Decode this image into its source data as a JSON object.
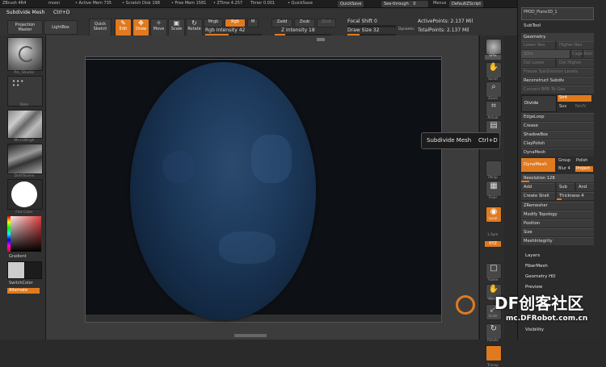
{
  "topbar": {
    "app": "ZBrush 4R4",
    "doc": "moon",
    "active_mem": "• Active Mem 735",
    "scratch": "• Scratch Disk 198",
    "free_mem": "• Free Mem 1581",
    "ztime": "• ZTime 4.257",
    "timer": "Timer 0.001",
    "quicksave_info": "• QuickSave",
    "quicksave_btn": "QuickSave",
    "see_through": "See-through",
    "see_through_val": "0",
    "menus": "Menus",
    "zscript": "DefaultZScript"
  },
  "toolbar": {
    "subdivide": "Subdivide Mesh",
    "shortcut": "Ctrl+D",
    "projection_master": "Projection Master",
    "lightbox": "LightBox",
    "quick_sketch": "Quick Sketch",
    "edit": "Edit",
    "draw": "Draw",
    "move": "Move",
    "scale": "Scale",
    "rotate": "Rotate",
    "mrgb": "Mrgb",
    "rgb": "Rgb",
    "m": "M",
    "rgb_intensity": "Rgb Intensity 42",
    "zadd": "Zadd",
    "zsub": "Zsub",
    "zcut": "Zcut",
    "z_intensity": "Z Intensity 18",
    "focal_shift": "Focal Shift 0",
    "draw_size": "Draw Size 32",
    "dynamic": "Dynamic",
    "active_points": "ActivePoints: 2.137 Mil",
    "total_points": "TotalPoints: 2.137 Mil",
    "rgb_intensity_level": 0.42,
    "z_intensity_level": 0.18,
    "draw_size_level": 0.25
  },
  "leftpanel": {
    "thumb_labels": [
      "Pm_Shader",
      "Dots",
      "MicroWrigh",
      "DotVScene",
      "Flat Color"
    ],
    "gradient": "Gradient",
    "switchcolor": "SwitchColor",
    "alternate": "Alternate"
  },
  "iconcol": {
    "labels": [
      "BPR",
      "SPix",
      "Scroll",
      "Zoom",
      "Actual",
      "AAHalf",
      "Persp",
      "Floor",
      "Local",
      "L.Sym",
      "Frame",
      "Move",
      "Scale",
      "Rotate",
      "Transp"
    ],
    "xyz": "XYZ"
  },
  "tooltip": {
    "label": "Subdivide Mesh",
    "key": "Ctrl+D"
  },
  "palette": {
    "tool_name": "PM3D_Plane3D_1",
    "subtool": "SubTool",
    "geometry": "Geometry",
    "lower_res": "Lower Res",
    "higher_res": "Higher Res",
    "sdiv": "SDiv",
    "cage": "Cage",
    "rstr": "Rstr",
    "del_lower": "Del Lower",
    "del_higher": "Del Higher",
    "freeze": "Freeze SubDivision Levels",
    "reconstruct": "Reconstruct Subdiv",
    "convert_bpr": "Convert BPR To Geo",
    "divide": "Divide",
    "smt": "Smt",
    "suv": "Suv",
    "reuv": "ReUV",
    "edgeloop": "EdgeLoop",
    "crease": "Crease",
    "shadowbox": "ShadowBox",
    "claypolish": "ClayPolish",
    "dynamesh": "DynaMesh",
    "dynamesh_btn": "DynaMesh",
    "group": "Group",
    "polish": "Polish",
    "blur": "Blur 4",
    "project": "Project",
    "resolution": "Resolution 128",
    "add": "Add",
    "sub": "Sub",
    "and": "And",
    "create_shell": "Create Shell",
    "thickness": "Thickness 4",
    "zremesher": "ZRemesher",
    "modify_topology": "Modify Topology",
    "position": "Position",
    "size": "Size",
    "meshintegrity": "MeshIntegrity",
    "layers": "Layers",
    "fibermesh": "FiberMesh",
    "geometry_hd": "Geometry HD",
    "preview": "Preview",
    "visibility": "Visibility"
  },
  "watermark": {
    "brand": "DF创客社区",
    "url": "mc.DFRobot.com.cn"
  },
  "colors": {
    "accent": "#e07a1f",
    "sphere": "#1d3a5c"
  }
}
